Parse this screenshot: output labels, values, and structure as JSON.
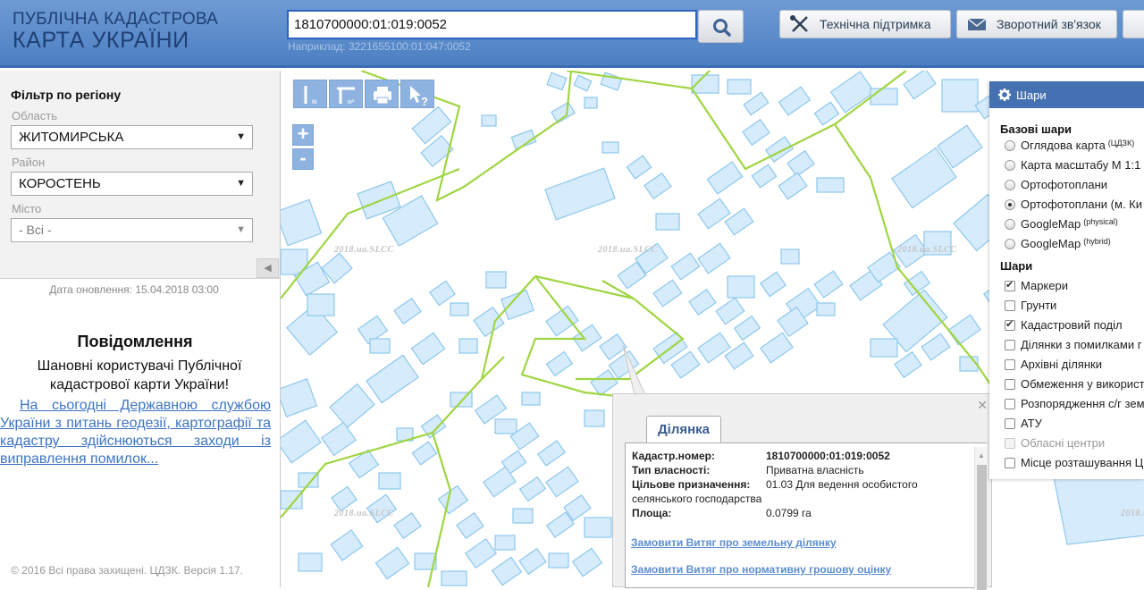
{
  "header": {
    "logo_line1": "ПУБЛІЧНА КАДАСТРОВА",
    "logo_line2": "КАРТА УКРАЇНИ",
    "search_value": "1810700000:01:019:0052",
    "search_hint": "Наприклад: 3221655100:01:047:0052",
    "support_label": "Технічна підтримка",
    "feedback_label": "Зворотний зв'язок"
  },
  "filter": {
    "title": "Фільтр по регіону",
    "oblast_label": "Область",
    "oblast_value": "ЖИТОМИРСЬКА",
    "rayon_label": "Район",
    "rayon_value": "КОРОСТЕНЬ",
    "misto_label": "Місто",
    "misto_value": "- Всі -"
  },
  "left": {
    "update_date": "Дата оновлення: 15.04.2018 03:00",
    "notice_title": "Повідомлення",
    "notice_sub": "Шановні користувачі Публічної кадастрової карти України!",
    "notice_link": "На сьогодні Державною службою України з питань геодезії, картографії та кадастру здійснюються заходи із виправлення помилок...",
    "copyright": "© 2016 Всі права захищені. ЦДЗК. Версія 1.17."
  },
  "map": {
    "watermark": "2018.ua.SLCC",
    "zoom_in": "+",
    "zoom_out": "-",
    "parcel_fill": "#d6ecfc",
    "parcel_stroke": "#8ec7ec",
    "boundary_color": "#9fd542"
  },
  "popup": {
    "tab": "Ділянка",
    "cadnum_label": "Кадастр.номер:",
    "cadnum_value": "1810700000:01:019:0052",
    "ownership_label": "Тип власності:",
    "ownership_value": "Приватна власність",
    "purpose_label": "Цільове призначення:",
    "purpose_value": "01.03 Для ведення особистого",
    "purpose_value2": "селянського господарства",
    "area_label": "Площа:",
    "area_value": "0.0799 га",
    "link1": "Замовити Витяг про земельну ділянку",
    "link2": "Замовити Витяг про нормативну грошову оцінку"
  },
  "layers": {
    "title": "Шари",
    "base_title": "Базові шари",
    "base": [
      {
        "label": "Оглядова карта",
        "sup": "(ЦДЗК)",
        "on": false
      },
      {
        "label": "Карта масштабу М 1:1",
        "sup": "",
        "on": false
      },
      {
        "label": "Ортофотоплани",
        "sup": "",
        "on": false
      },
      {
        "label": "Ортофотоплани (м. Ки",
        "sup": "",
        "on": true
      },
      {
        "label": "GoogleMap",
        "sup": "(physical)",
        "on": false
      },
      {
        "label": "GoogleMap",
        "sup": "(hybrid)",
        "on": false
      }
    ],
    "overlay_title": "Шари",
    "overlays": [
      {
        "label": "Маркери",
        "on": true,
        "disabled": false
      },
      {
        "label": "Грунти",
        "on": false,
        "disabled": false
      },
      {
        "label": "Кадастровий поділ",
        "on": true,
        "disabled": false
      },
      {
        "label": "Ділянки з помилками г",
        "on": false,
        "disabled": false
      },
      {
        "label": "Архівні ділянки",
        "on": false,
        "disabled": false
      },
      {
        "label": "Обмеження у використ",
        "on": false,
        "disabled": false
      },
      {
        "label": "Розпорядження с/г зем",
        "on": false,
        "disabled": false
      },
      {
        "label": "АТУ",
        "on": false,
        "disabled": false
      },
      {
        "label": "Обласні центри",
        "on": false,
        "disabled": true
      },
      {
        "label": "Місце розташування Ц",
        "on": false,
        "disabled": false
      }
    ]
  }
}
